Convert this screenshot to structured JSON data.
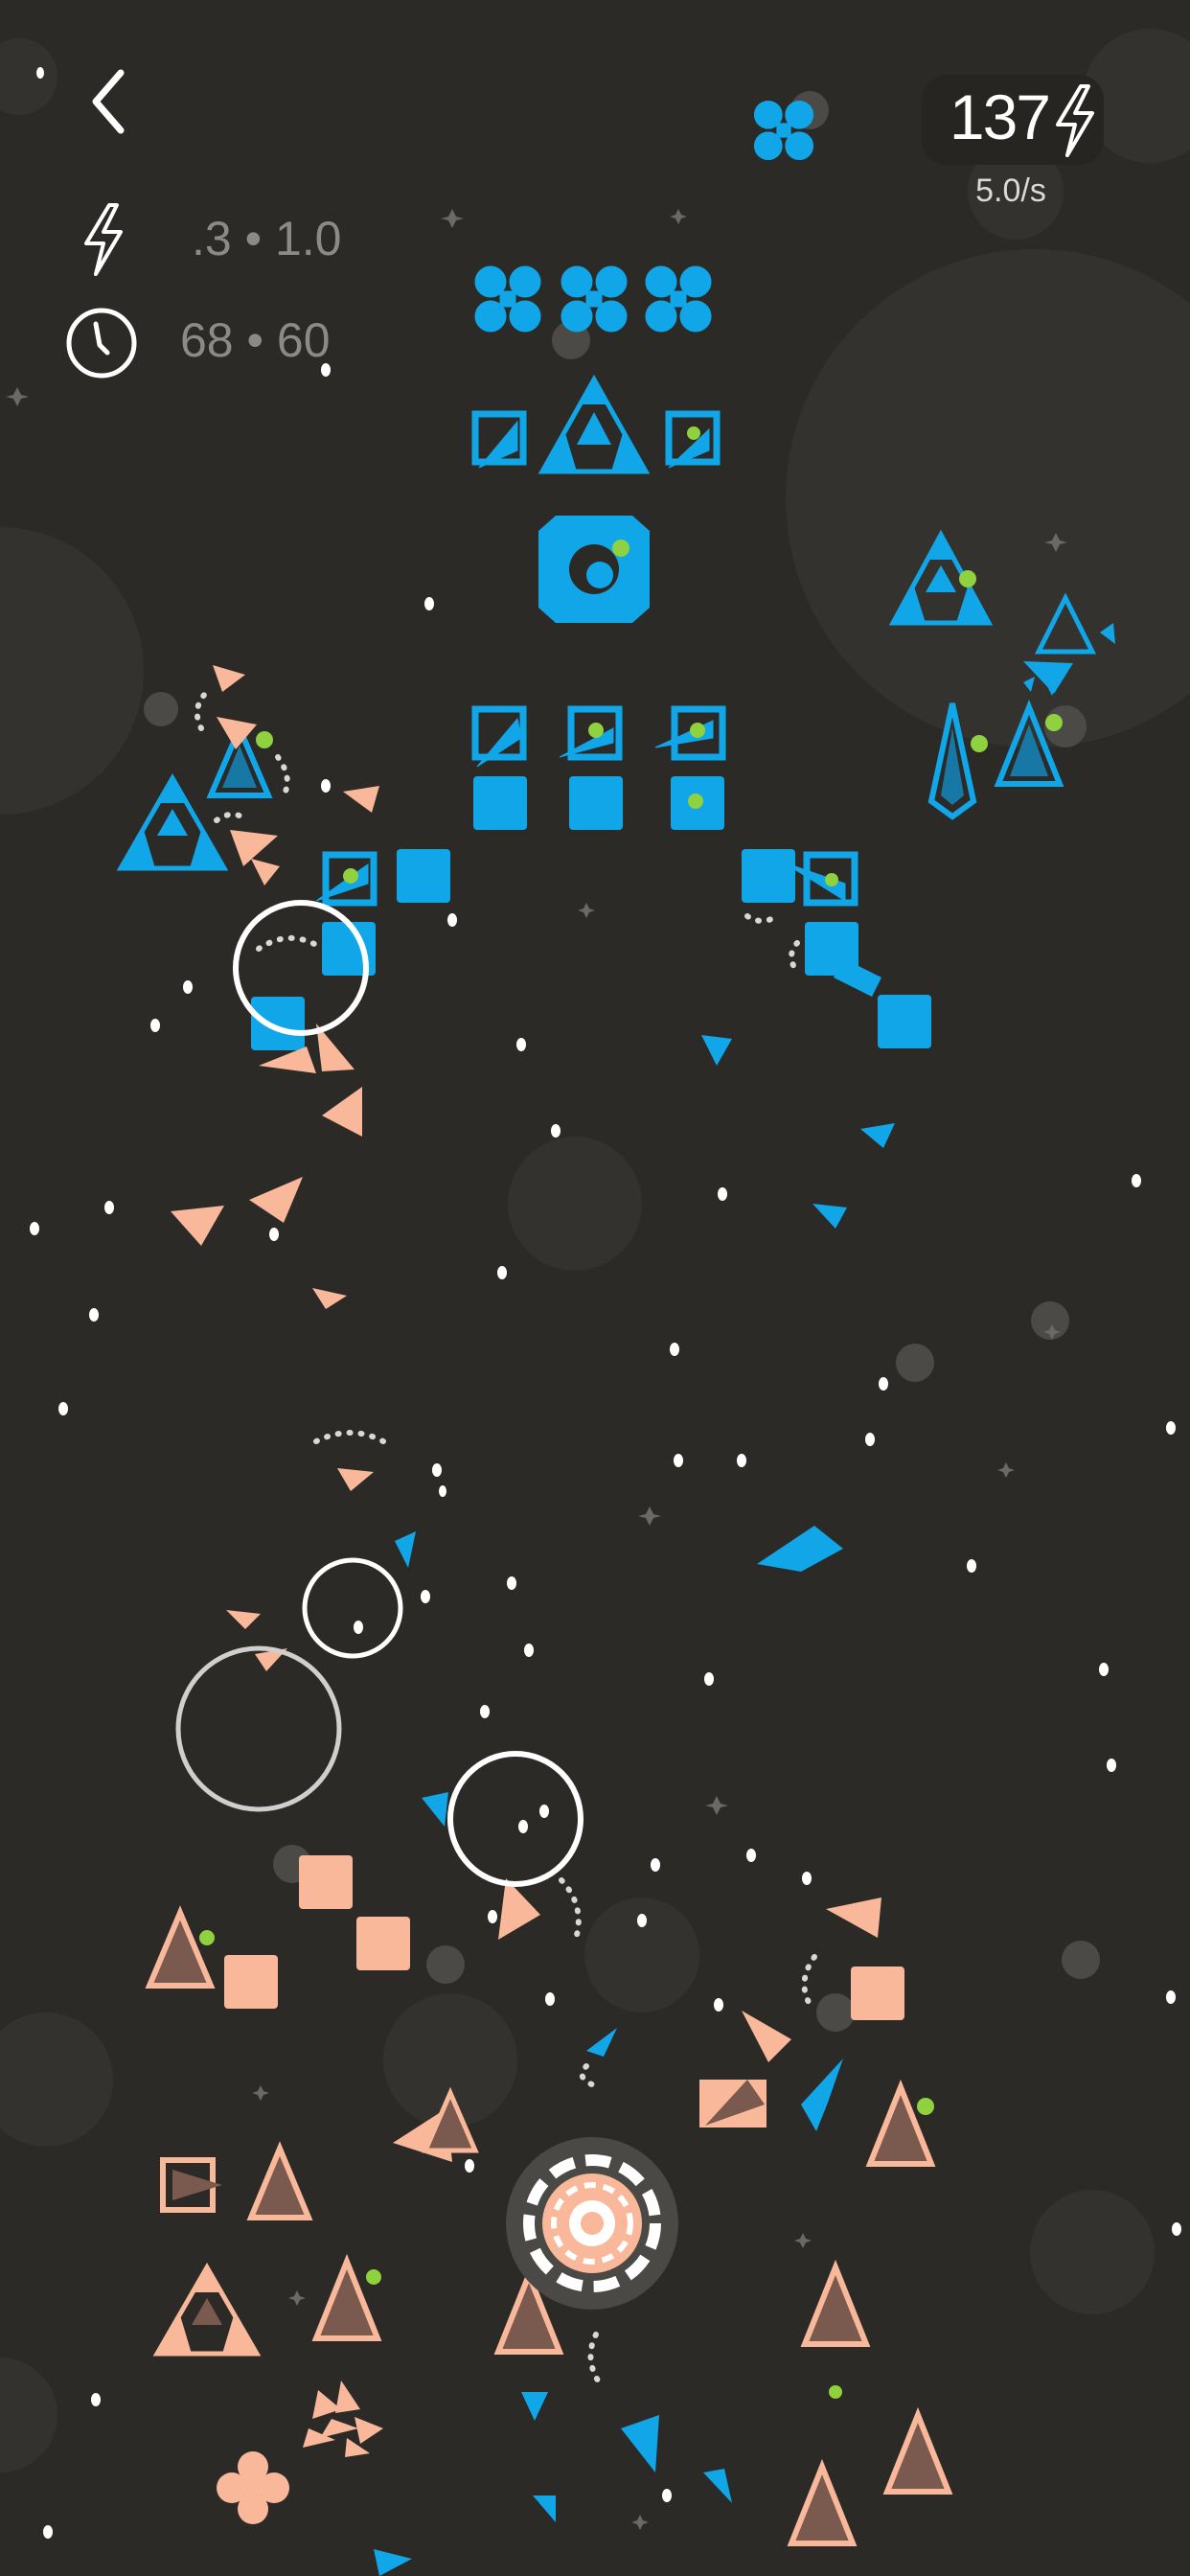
{
  "hud": {
    "back_icon": "chevron-left-icon",
    "energy_value": "137",
    "energy_icon": "lightning-bolt-icon",
    "energy_rate": "5.0/s",
    "stats": [
      {
        "icon": "lightning-bolt-icon",
        "text": ".3 • 1.0"
      },
      {
        "icon": "clock-icon",
        "text": "68 • 60"
      }
    ]
  },
  "colors": {
    "background": "#2b2a27",
    "enemy_blue": "#10a6e8",
    "player_peach": "#f9b89a",
    "accent_green": "#8fd13f",
    "white": "#ffffff",
    "grey_circle": "#3a3936"
  }
}
